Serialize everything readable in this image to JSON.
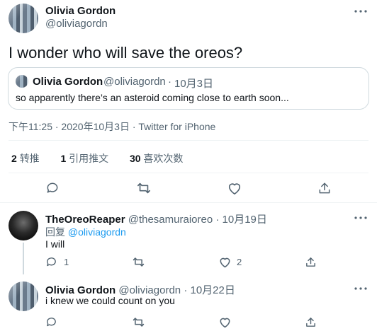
{
  "main_tweet": {
    "author_name": "Olivia Gordon",
    "author_handle": "@oliviagordn",
    "text": "I wonder who will save the oreos?",
    "quote": {
      "author_name": "Olivia Gordon",
      "author_handle": "@oliviagordn",
      "date": "10月3日",
      "text": "so apparently there’s an asteroid coming close to earth soon..."
    },
    "meta": "下午11:25 · 2020年10月3日 · Twitter for iPhone",
    "stats": {
      "retweets_count": "2",
      "retweets_label": "转推",
      "quotes_count": "1",
      "quotes_label": "引用推文",
      "likes_count": "30",
      "likes_label": "喜欢次数"
    }
  },
  "replies": [
    {
      "author_name": "TheOreoReaper",
      "author_handle": "@thesamuraioreo",
      "date": "10月19日",
      "replying_prefix": "回复",
      "replying_to": "@oliviagordn",
      "text": "I will",
      "reply_count": "1",
      "like_count": "2"
    },
    {
      "author_name": "Olivia Gordon",
      "author_handle": "@oliviagordn",
      "date": "10月22日",
      "text": "i knew we could count on you"
    }
  ],
  "icons": {
    "more": "more-icon",
    "reply": "reply-icon",
    "retweet": "retweet-icon",
    "like": "like-icon",
    "share": "share-icon"
  },
  "colors": {
    "link": "#1d9bf0",
    "muted": "#536471",
    "border": "#cfd9de"
  }
}
